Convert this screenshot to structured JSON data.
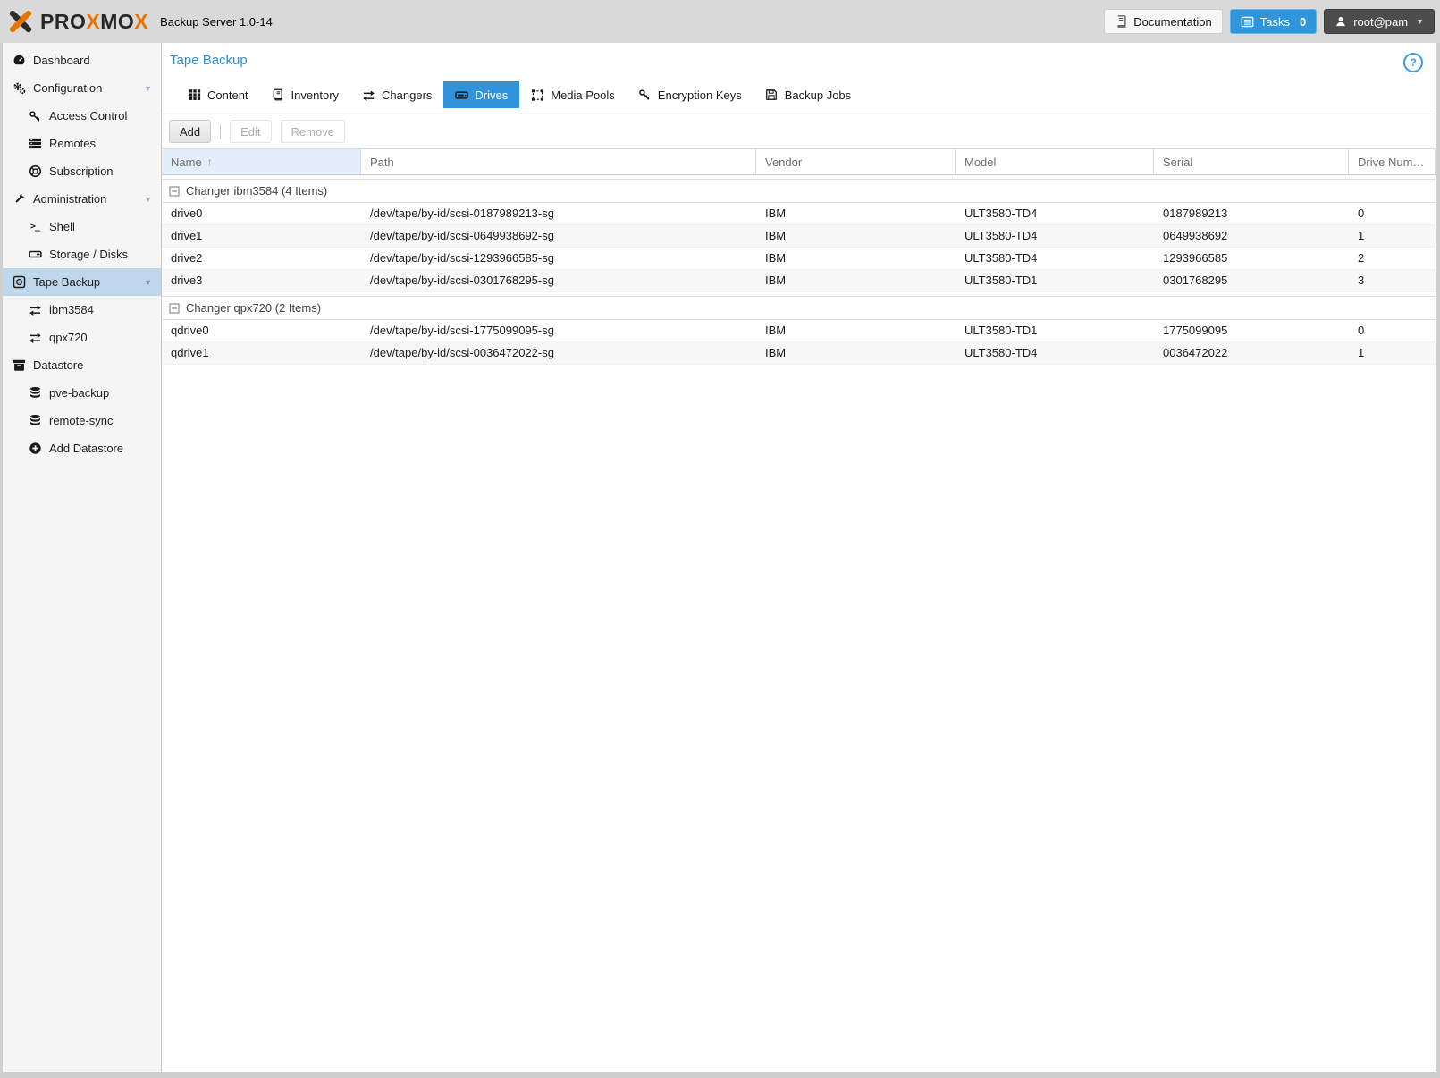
{
  "topbar": {
    "logo_parts": {
      "p1": "PRO",
      "p2": "X",
      "p3": "MO",
      "p4": "X"
    },
    "product": "Backup Server 1.0-14",
    "documentation_label": "Documentation",
    "tasks_label": "Tasks",
    "tasks_count": "0",
    "user_label": "root@pam"
  },
  "glyphs": {
    "caret_down": "▼",
    "terminal": ">_",
    "sort_asc": "↑",
    "help": "?"
  },
  "colors": {
    "accent_blue": "#3094dd",
    "logo_orange": "#e87400",
    "sidebar_selected_bg": "#bfd7ec",
    "topbar_bg": "#d9d9d9"
  },
  "sidebar": {
    "items": {
      "dashboard": "Dashboard",
      "configuration": "Configuration",
      "access_control": "Access Control",
      "remotes": "Remotes",
      "subscription": "Subscription",
      "administration": "Administration",
      "shell": "Shell",
      "storage_disks": "Storage / Disks",
      "tape_backup": "Tape Backup",
      "ibm3584": "ibm3584",
      "qpx720": "qpx720",
      "datastore": "Datastore",
      "pve_backup": "pve-backup",
      "remote_sync": "remote-sync",
      "add_datastore": "Add Datastore"
    }
  },
  "main": {
    "title": "Tape Backup",
    "tabs": {
      "content": "Content",
      "inventory": "Inventory",
      "changers": "Changers",
      "drives": "Drives",
      "media_pools": "Media Pools",
      "encryption_keys": "Encryption Keys",
      "backup_jobs": "Backup Jobs"
    },
    "active_tab": "Drives",
    "toolbar": {
      "add": "Add",
      "edit": "Edit",
      "remove": "Remove"
    },
    "table": {
      "columns": {
        "name": "Name",
        "path": "Path",
        "vendor": "Vendor",
        "model": "Model",
        "serial": "Serial",
        "drive_num": "Drive Num…"
      },
      "sorted_column": "Name",
      "groups": [
        {
          "header": "Changer ibm3584 (4 Items)",
          "rows": [
            [
              "drive0",
              "/dev/tape/by-id/scsi-0187989213-sg",
              "IBM",
              "ULT3580-TD4",
              "0187989213",
              "0"
            ],
            [
              "drive1",
              "/dev/tape/by-id/scsi-0649938692-sg",
              "IBM",
              "ULT3580-TD4",
              "0649938692",
              "1"
            ],
            [
              "drive2",
              "/dev/tape/by-id/scsi-1293966585-sg",
              "IBM",
              "ULT3580-TD4",
              "1293966585",
              "2"
            ],
            [
              "drive3",
              "/dev/tape/by-id/scsi-0301768295-sg",
              "IBM",
              "ULT3580-TD1",
              "0301768295",
              "3"
            ]
          ]
        },
        {
          "header": "Changer qpx720 (2 Items)",
          "rows": [
            [
              "qdrive0",
              "/dev/tape/by-id/scsi-1775099095-sg",
              "IBM",
              "ULT3580-TD1",
              "1775099095",
              "0"
            ],
            [
              "qdrive1",
              "/dev/tape/by-id/scsi-0036472022-sg",
              "IBM",
              "ULT3580-TD4",
              "0036472022",
              "1"
            ]
          ]
        }
      ]
    }
  }
}
